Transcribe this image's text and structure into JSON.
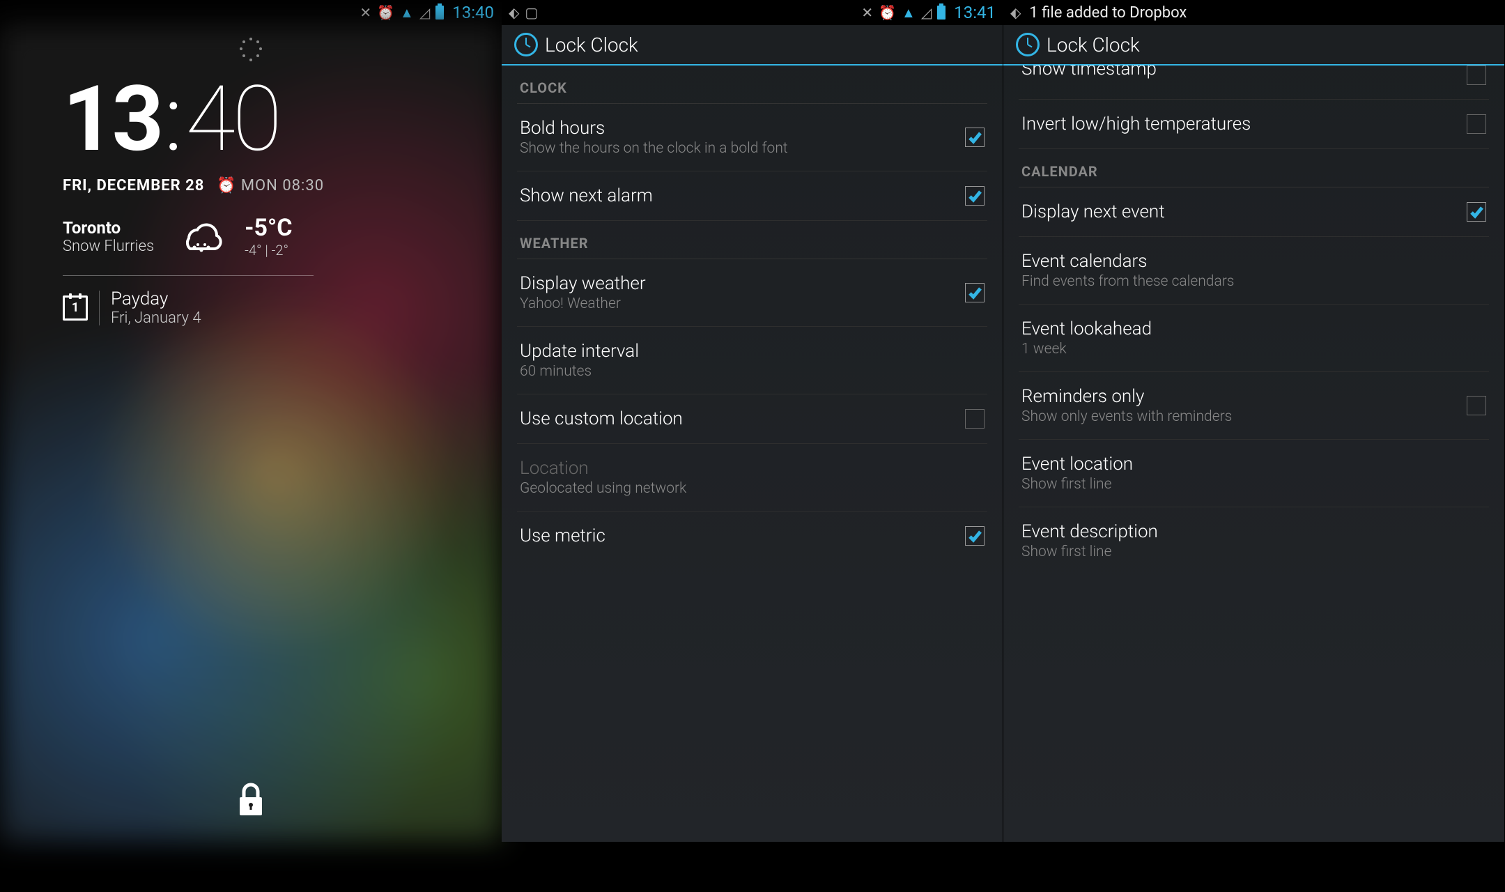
{
  "phone1": {
    "status": {
      "time": "13:40"
    },
    "clock": {
      "hours": "13",
      "mins": "40"
    },
    "date": "FRI, DECEMBER 28",
    "alarm": "MON 08:30",
    "weather": {
      "city": "Toronto",
      "condition": "Snow Flurries",
      "temp": "-5°C",
      "hilo": "-4° | -2°"
    },
    "event": {
      "day": "1",
      "title": "Payday",
      "date": "Fri, January 4"
    }
  },
  "phone2": {
    "status": {
      "time": "13:41"
    },
    "app_title": "Lock Clock",
    "sections": {
      "clock_header": "CLOCK",
      "weather_header": "WEATHER"
    },
    "prefs": {
      "bold_hours": {
        "title": "Bold hours",
        "sub": "Show the hours on the clock in a bold font"
      },
      "show_next_alarm": {
        "title": "Show next alarm"
      },
      "display_weather": {
        "title": "Display weather",
        "sub": "Yahoo! Weather"
      },
      "update_interval": {
        "title": "Update interval",
        "sub": "60 minutes"
      },
      "custom_location": {
        "title": "Use custom location"
      },
      "location": {
        "title": "Location",
        "sub": "Geolocated using network"
      },
      "use_metric": {
        "title": "Use metric"
      }
    }
  },
  "phone3": {
    "notification": "1 file added to Dropbox",
    "app_title": "Lock Clock",
    "sections": {
      "calendar_header": "CALENDAR"
    },
    "prefs": {
      "show_timestamp": {
        "title": "Show timestamp"
      },
      "invert_temps": {
        "title": "Invert low/high temperatures"
      },
      "display_next_event": {
        "title": "Display next event"
      },
      "event_calendars": {
        "title": "Event calendars",
        "sub": "Find events from these calendars"
      },
      "event_lookahead": {
        "title": "Event lookahead",
        "sub": "1 week"
      },
      "reminders_only": {
        "title": "Reminders only",
        "sub": "Show only events with reminders"
      },
      "event_location": {
        "title": "Event location",
        "sub": "Show first line"
      },
      "event_description": {
        "title": "Event description",
        "sub": "Show first line"
      }
    }
  }
}
